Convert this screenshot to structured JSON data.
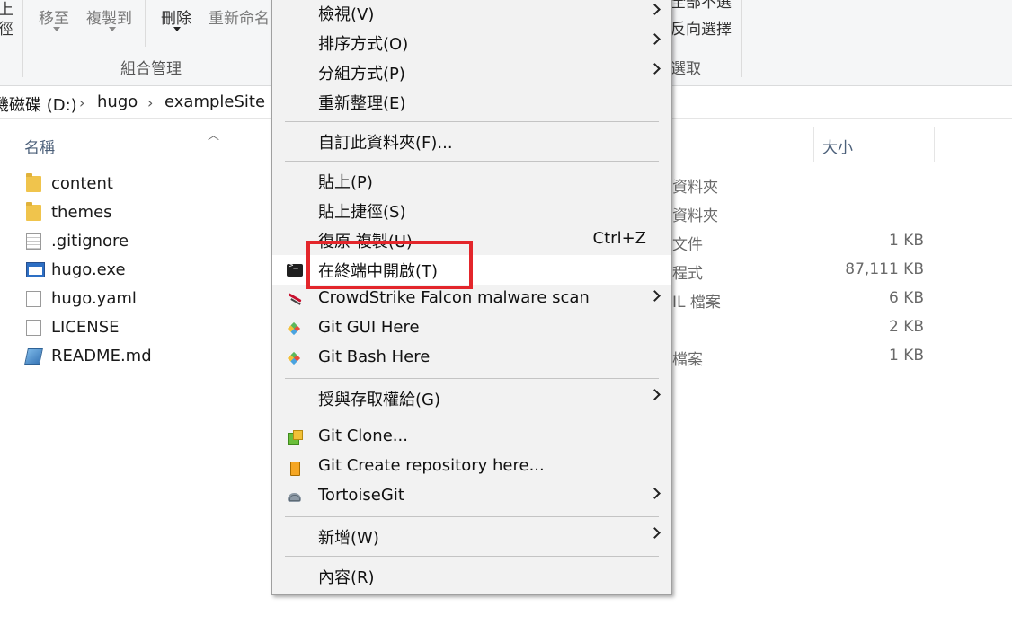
{
  "ribbon": {
    "left_partial_top": "上",
    "left_partial_bottom": "徑",
    "move_to": "移至",
    "copy_to": "複製到",
    "delete": "刪除",
    "rename": "重新命名",
    "organize_group": "組合管理",
    "select_all_partial": "全部不選",
    "invert_selection_partial": "反向選擇",
    "select_group_partial": "選取"
  },
  "address": {
    "drive": "機磁碟 (D:)",
    "folder1": "hugo",
    "folder2": "exampleSite"
  },
  "columns": {
    "name": "名稱",
    "size": "大小"
  },
  "files": [
    {
      "name": "content",
      "type": "資料夾",
      "size": "",
      "icon": "folder-icon"
    },
    {
      "name": "themes",
      "type": "資料夾",
      "size": "",
      "icon": "folder-icon"
    },
    {
      "name": ".gitignore",
      "type": "文件",
      "size": "1 KB",
      "icon": "text-file-icon"
    },
    {
      "name": "hugo.exe",
      "type": "程式",
      "size": "87,111 KB",
      "icon": "exe-icon"
    },
    {
      "name": "hugo.yaml",
      "type": "IL 檔案",
      "size": "6 KB",
      "icon": "file-icon"
    },
    {
      "name": "LICENSE",
      "type": "",
      "size": "2 KB",
      "icon": "file-icon"
    },
    {
      "name": "README.md",
      "type": "檔案",
      "size": "1 KB",
      "icon": "markdown-icon"
    }
  ],
  "menu": {
    "view": "檢視(V)",
    "sort_by": "排序方式(O)",
    "group_by": "分組方式(P)",
    "refresh": "重新整理(E)",
    "customize_folder": "自訂此資料夾(F)...",
    "paste": "貼上(P)",
    "paste_shortcut": "貼上捷徑(S)",
    "undo_copy": "復原 複製(U)",
    "undo_shortcut": "Ctrl+Z",
    "open_in_terminal": "在終端中開啟(T)",
    "crowdstrike": "CrowdStrike Falcon malware scan",
    "git_gui": "Git GUI Here",
    "git_bash": "Git Bash Here",
    "give_access": "授與存取權給(G)",
    "git_clone": "Git Clone...",
    "git_create_repo": "Git Create repository here...",
    "tortoisegit": "TortoiseGit",
    "new": "新增(W)",
    "properties": "內容(R)"
  },
  "colors": {
    "highlight_box": "#e3262b",
    "menu_background": "#f2f2f2",
    "folder_yellow": "#f0c44c"
  }
}
